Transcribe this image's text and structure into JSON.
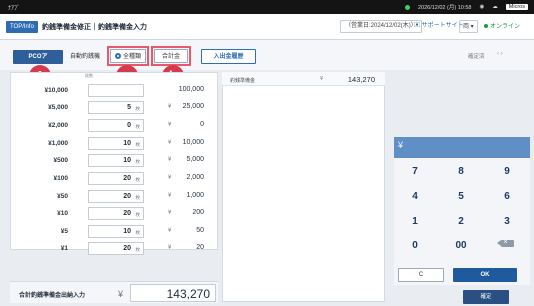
{
  "window_bar": {
    "title": "ﾅｱﾌﾞ",
    "datetime": "2026/12/02 (月) 10:58",
    "brand": "Micros"
  },
  "header": {
    "logo": "TOP/Info",
    "breadcrumb": "釣銭準備金修正｜釣銭準備金入力",
    "business_date": "（営業日:2024/12/02(木)）",
    "support": "サポートサイト",
    "user_icon": "両 ▾",
    "status": "オンライン"
  },
  "toolbar": {
    "pco_label": "PCOア",
    "auto_label": "自動釣銭機",
    "all_label": "全種類",
    "sum_label": "合計金",
    "history_label": "入出金履歴",
    "confirm_top": "確定済",
    "pager": "‹ ›"
  },
  "annotations": {
    "badge_1": "1",
    "badge_a": "a",
    "badge_b": "b"
  },
  "denominations": {
    "count_header": "枚数",
    "unit": "枚",
    "yen": "¥",
    "rows": [
      {
        "denom": "¥10,000",
        "count": "",
        "amount": "100,000"
      },
      {
        "denom": "¥5,000",
        "count": "5",
        "amount": "25,000"
      },
      {
        "denom": "¥2,000",
        "count": "0",
        "amount": "0"
      },
      {
        "denom": "¥1,000",
        "count": "10",
        "amount": "10,000"
      },
      {
        "denom": "¥500",
        "count": "10",
        "amount": "5,000"
      },
      {
        "denom": "¥100",
        "count": "20",
        "amount": "2,000"
      },
      {
        "denom": "¥50",
        "count": "20",
        "amount": "1,000"
      },
      {
        "denom": "¥10",
        "count": "20",
        "amount": "200"
      },
      {
        "denom": "¥5",
        "count": "10",
        "amount": "50"
      },
      {
        "denom": "¥1",
        "count": "20",
        "amount": "20"
      }
    ]
  },
  "total": {
    "label": "合計釣銭準備金出納入力",
    "yen": "¥",
    "value": "143,270"
  },
  "summary": {
    "label": "釣銭準備金",
    "yen": "¥",
    "value": "143,270"
  },
  "keypad": {
    "display_yen": "¥",
    "keys": [
      [
        "7",
        "8",
        "9"
      ],
      [
        "4",
        "5",
        "6"
      ],
      [
        "1",
        "2",
        "3"
      ],
      [
        "0",
        "00",
        ""
      ]
    ],
    "clear_label": "C",
    "ok_label": "OK",
    "confirm_label": "確定"
  },
  "colors": {
    "primary": "#2f6db3",
    "dark_primary": "#2a4f82",
    "badge": "#d63a4c",
    "highlight": "#e85a6b",
    "online": "#1a9a4a"
  }
}
